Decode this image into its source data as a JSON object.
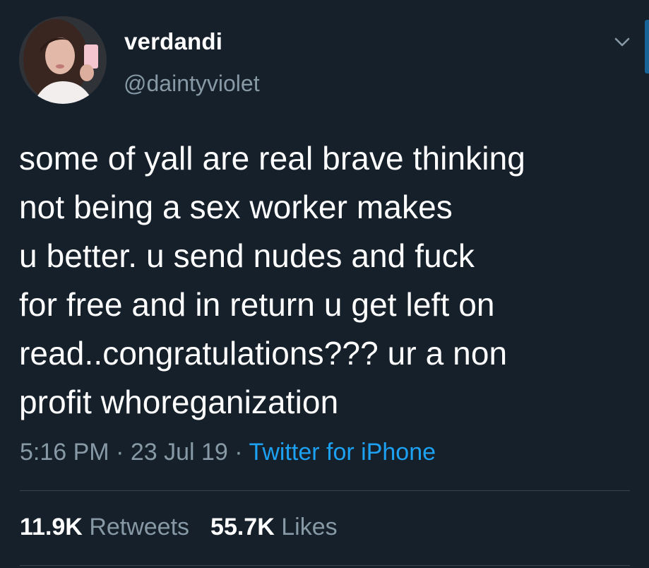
{
  "user": {
    "display_name": "verdandi",
    "handle": "@daintyviolet",
    "avatar_icon": "profile-photo"
  },
  "tweet": {
    "text": "some of yall are real brave thinking\nnot being a sex worker makes\nu better. u send nudes and fuck\nfor free and in return u get left on\nread..congratulations??? ur a non\nprofit whoreganization",
    "time": "5:16 PM",
    "separator": " · ",
    "date": "23 Jul 19",
    "source": "Twitter for iPhone"
  },
  "stats": {
    "retweets_count": "11.9K",
    "retweets_label": "Retweets",
    "likes_count": "55.7K",
    "likes_label": "Likes"
  },
  "icons": {
    "menu": "chevron-down-icon"
  },
  "colors": {
    "background": "#15202b",
    "text_primary": "#ffffff",
    "text_secondary": "#8899a6",
    "link": "#1da1f2",
    "divider": "#38444d"
  }
}
